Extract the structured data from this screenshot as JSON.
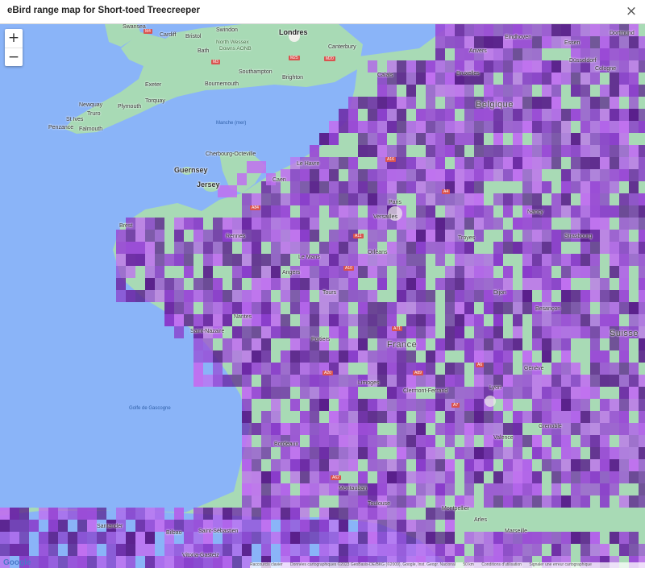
{
  "window": {
    "title": "eBird range map for Short-toed Treecreeper",
    "close_glyph": "×"
  },
  "zoom": {
    "in_label": "+",
    "out_label": "−"
  },
  "species": "Short-toed Treecreeper",
  "colors": {
    "ocean": "#8ab4f8",
    "land": "#a8dab5",
    "urban": "#eef0ea",
    "range_light": "#c070f0",
    "range_mid": "#9a4ad6",
    "range_dark": "#5a1f8c"
  },
  "places": {
    "swansea": "Swansea",
    "cardiff": "Cardiff",
    "bristol": "Bristol",
    "swindon": "Swindon",
    "londres": "Londres",
    "bath": "Bath",
    "north_wessex": "North Wessex",
    "downs_aonb": "Downs AONB",
    "canterbury": "Canterbury",
    "exeter": "Exeter",
    "southampton": "Southampton",
    "bournemouth": "Bournemouth",
    "brighton": "Brighton",
    "newquay": "Newquay",
    "plymouth": "Plymouth",
    "torquay": "Torquay",
    "truro": "Truro",
    "st_ives": "St Ives",
    "penzance": "Penzance",
    "falmouth": "Falmouth",
    "manche": "Manche (mer)",
    "cherbourg": "Cherbourg-Octeville",
    "guernsey": "Guernsey",
    "jersey": "Jersey",
    "calais": "Calais",
    "anvers": "Anvers",
    "eindhoven": "Eindhoven",
    "dortmund": "Dortmund",
    "dusseldorf": "Düsseldorf",
    "cologne": "Cologne",
    "bruxelles": "Bruxelles",
    "belgique": "Belgique",
    "essen": "Essen",
    "france": "France",
    "lyon": "Lyon",
    "geneve": "Genève",
    "suisse": "Suisse",
    "golfe": "Golfe de Gascogne",
    "marseille": "Marseille",
    "bilbao": "Bilbao",
    "saint_sebastien": "Saint-Sébastien",
    "santander": "Santander",
    "vitoria": "Vitoria-Gasteiz",
    "le_mans": "Le Mans",
    "brest": "Brest",
    "versailles": "Versailles",
    "troyes": "Troyes",
    "strasbourg": "Strasbourg",
    "tours": "Tours",
    "saint_nazaire": "Saint-Nazaire",
    "bordeaux": "Bordeaux",
    "montauban": "Montauban",
    "le_havre": "Le Havre",
    "paris": "Paris",
    "nancy": "Nancy",
    "caen": "Caen",
    "rennes": "Rennes",
    "angers": "Angers",
    "orleans": "Orléans",
    "dijon": "Dijon",
    "besancon": "Besançon",
    "limoges": "Limoges",
    "clermont": "Clermont-Ferrand",
    "toulouse": "Toulouse",
    "montpellier": "Montpellier",
    "grenoble": "Grenoble",
    "valence": "Valence",
    "nantes": "Nantes",
    "poitiers": "Poitiers",
    "arles": "Arles"
  },
  "road_shields": [
    "A16",
    "A4",
    "A11",
    "A10",
    "A71",
    "A89",
    "A20",
    "A7",
    "A62",
    "M4",
    "M3",
    "M25",
    "M20",
    "A84",
    "A6"
  ],
  "attribution": {
    "logo": "Google",
    "keys": "Raccourcis clavier",
    "data": "Données cartographiques ©2023 GeoBasis-DE/BKG (©2009), Google, Inst. Geogr. Nacional",
    "scale": "50 km",
    "terms": "Conditions d'utilisation",
    "report": "Signaler une erreur cartographique"
  }
}
